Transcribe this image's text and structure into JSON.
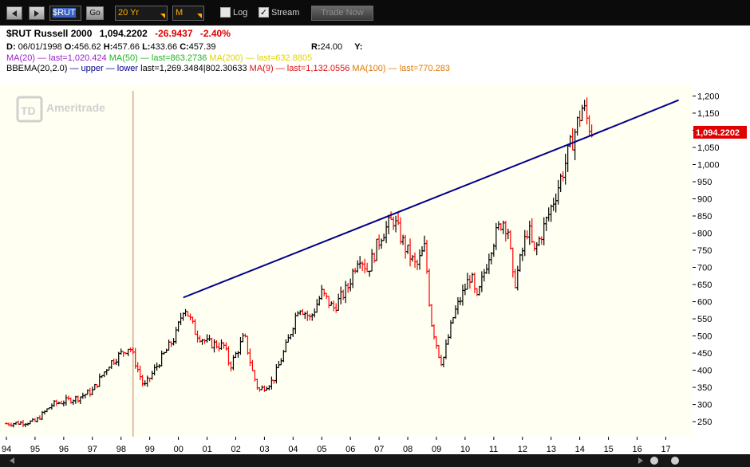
{
  "toolbar": {
    "symbol": "$RUT",
    "go_label": "Go",
    "period": "20 Yr",
    "frequency": "M",
    "log_label": "Log",
    "stream_label": "Stream",
    "stream_checked": "✓",
    "trade_label": "Trade Now"
  },
  "header": {
    "symbol": "$RUT Russell 2000",
    "last": "1,094.2202",
    "change": "-26.9437",
    "change_pct": "-2.40%",
    "date_label": "D:",
    "date": "06/01/1998",
    "open_label": "O:",
    "open": "456.62",
    "high_label": "H:",
    "high": "457.66",
    "low_label": "L:",
    "low": "433.66",
    "close_label": "C:",
    "close": "457.39",
    "r_label": "R:",
    "r": "24.00",
    "y_label": "Y:"
  },
  "studies": {
    "ma20": "MA(20)",
    "ma20_last": "— last=1,020.424",
    "ma50": "MA(50)",
    "ma50_last": "— last=863.2736",
    "ma200": "MA(200)",
    "ma200_last": "— last=632.8805",
    "bbema": "BBEMA(20,2.0)",
    "bbema_upper": "— upper",
    "bbema_lower": "— lower",
    "bbema_last": "last=1,269.3484|802.30633",
    "ma9": "MA(9)",
    "ma9_last": "— last=1,132.0556",
    "ma100": "MA(100)",
    "ma100_last": "— last=770.283"
  },
  "watermark": "Ameritrade",
  "colors": {
    "up": "#000000",
    "down": "#ff0000",
    "trendline": "#00008b",
    "chart_bg": "#fffff2",
    "crosshair": "#c08060",
    "price_label_bg": "#e00000"
  },
  "chart_data": {
    "type": "bar",
    "title": "$RUT Russell 2000",
    "frequency": "Monthly",
    "y_ticks": [
      "250",
      "300",
      "350",
      "400",
      "450",
      "500",
      "550",
      "600",
      "650",
      "700",
      "750",
      "800",
      "850",
      "900",
      "950",
      "1,000",
      "1,050",
      "1,100",
      "1,150",
      "1,200"
    ],
    "x_ticks": [
      "94",
      "95",
      "96",
      "97",
      "98",
      "99",
      "00",
      "01",
      "02",
      "03",
      "04",
      "05",
      "06",
      "07",
      "08",
      "09",
      "10",
      "11",
      "12",
      "13",
      "14",
      "15",
      "16",
      "17"
    ],
    "ylim": [
      220,
      1215
    ],
    "xlim": [
      1994.0,
      2017.6
    ],
    "last_price_label": "1,094.2202",
    "trendline": {
      "x": [
        2000.17,
        2014.25,
        2017.45
      ],
      "y": [
        612,
        1080,
        1188
      ]
    },
    "crosshair_x": 1998.42,
    "anchors": [
      [
        1994.0,
        244
      ],
      [
        1995.0,
        250
      ],
      [
        1995.6,
        300
      ],
      [
        1996.5,
        320
      ],
      [
        1997.0,
        340
      ],
      [
        1997.6,
        420
      ],
      [
        1998.3,
        470
      ],
      [
        1998.8,
        350
      ],
      [
        1999.3,
        420
      ],
      [
        1999.9,
        500
      ],
      [
        2000.2,
        590
      ],
      [
        2000.6,
        510
      ],
      [
        2001.0,
        480
      ],
      [
        2001.6,
        470
      ],
      [
        2001.8,
        410
      ],
      [
        2002.3,
        500
      ],
      [
        2002.6,
        390
      ],
      [
        2002.8,
        340
      ],
      [
        2003.3,
        370
      ],
      [
        2003.8,
        480
      ],
      [
        2004.2,
        590
      ],
      [
        2004.6,
        550
      ],
      [
        2005.0,
        625
      ],
      [
        2005.4,
        580
      ],
      [
        2005.9,
        640
      ],
      [
        2006.3,
        740
      ],
      [
        2006.6,
        690
      ],
      [
        2007.1,
        800
      ],
      [
        2007.5,
        840
      ],
      [
        2007.9,
        760
      ],
      [
        2008.3,
        700
      ],
      [
        2008.6,
        760
      ],
      [
        2008.8,
        550
      ],
      [
        2009.1,
        440
      ],
      [
        2009.2,
        420
      ],
      [
        2009.6,
        560
      ],
      [
        2010.2,
        680
      ],
      [
        2010.4,
        600
      ],
      [
        2010.9,
        760
      ],
      [
        2011.3,
        840
      ],
      [
        2011.5,
        810
      ],
      [
        2011.7,
        640
      ],
      [
        2012.2,
        820
      ],
      [
        2012.4,
        740
      ],
      [
        2012.9,
        850
      ],
      [
        2013.3,
        950
      ],
      [
        2013.7,
        1060
      ],
      [
        2014.1,
        1170
      ],
      [
        2014.3,
        1120
      ],
      [
        2014.45,
        1094
      ]
    ],
    "bar_colors_hint": "black = up month, red = down month"
  }
}
